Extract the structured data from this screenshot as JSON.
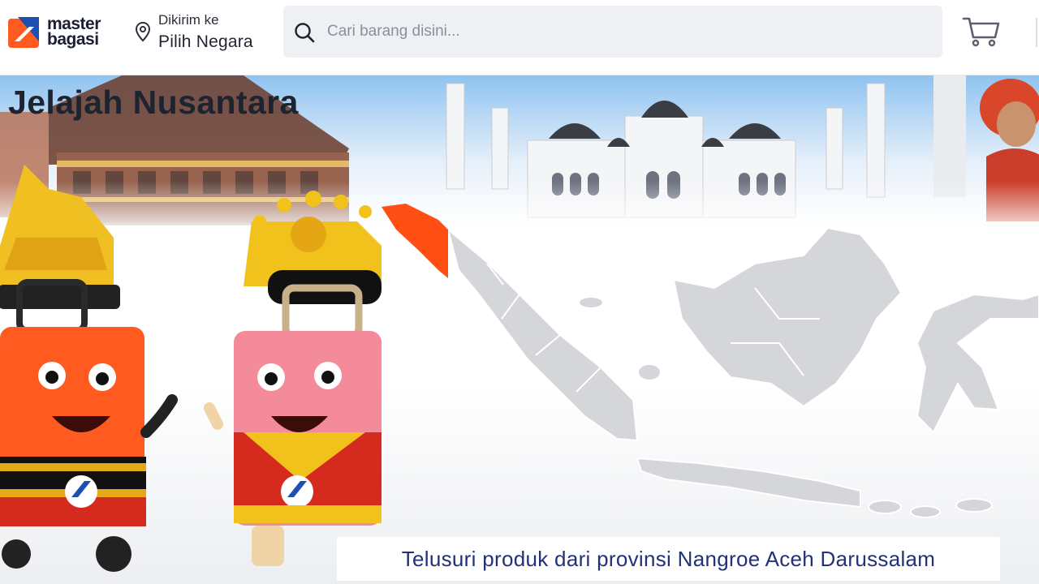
{
  "header": {
    "logo": {
      "line1": "master",
      "line2": "bagasi"
    },
    "ship_to": {
      "label": "Dikirim ke",
      "value": "Pilih Negara"
    },
    "search": {
      "placeholder": "Cari barang disini..."
    }
  },
  "banner": {
    "title": "Jelajah Nusantara",
    "caption": "Telusuri produk dari provinsi Nangroe Aceh Darussalam",
    "highlight_province_color": "#ff4f14"
  },
  "colors": {
    "brand_orange": "#ff5a1f",
    "brand_blue": "#1d4fb0",
    "text_dark": "#1e2330",
    "caption_blue": "#23307a",
    "map_gray": "#d4d6da"
  },
  "icons": {
    "location": "map-pin-icon",
    "search": "search-icon",
    "cart": "shopping-cart-icon"
  }
}
